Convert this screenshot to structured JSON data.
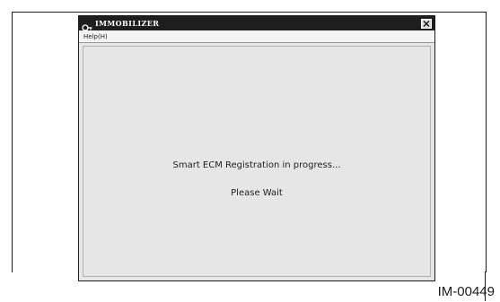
{
  "window": {
    "title": "IMMOBILIZER",
    "title_icon": "key-icon",
    "close_icon": "close-icon"
  },
  "menu": {
    "items": [
      "Help(H)"
    ]
  },
  "content": {
    "status_message": "Smart ECM Registration in progress...",
    "wait_message": "Please Wait"
  },
  "figure": {
    "id": "IM-00449"
  },
  "colors": {
    "titlebar": "#1e1e1e",
    "window_bg": "#e6e6e6",
    "menubar_bg": "#f4f4f4"
  }
}
